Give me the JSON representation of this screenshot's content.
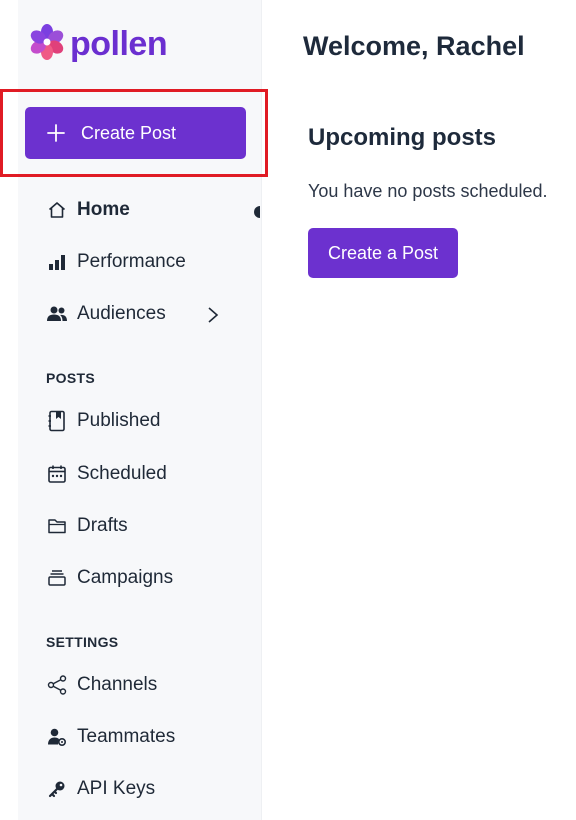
{
  "brand": {
    "name": "pollen",
    "color": "#6b2fd0",
    "logo_icon": "flower-icon"
  },
  "sidebar": {
    "create_post_label": "Create Post",
    "create_post_icon": "plus-icon",
    "highlight_color": "#e01b24",
    "nav": [
      {
        "label": "Home",
        "icon": "home-icon",
        "active": true
      },
      {
        "label": "Performance",
        "icon": "bar-chart-icon"
      },
      {
        "label": "Audiences",
        "icon": "people-icon",
        "has_submenu": true
      }
    ],
    "posts_section": {
      "title": "POSTS",
      "items": [
        {
          "label": "Published",
          "icon": "book-icon"
        },
        {
          "label": "Scheduled",
          "icon": "calendar-icon"
        },
        {
          "label": "Drafts",
          "icon": "folder-icon"
        },
        {
          "label": "Campaigns",
          "icon": "stack-icon"
        }
      ]
    },
    "settings_section": {
      "title": "SETTINGS",
      "items": [
        {
          "label": "Channels",
          "icon": "share-icon"
        },
        {
          "label": "Teammates",
          "icon": "user-gear-icon"
        },
        {
          "label": "API Keys",
          "icon": "key-icon"
        }
      ]
    }
  },
  "main": {
    "welcome": "Welcome, Rachel",
    "upcoming_title": "Upcoming posts",
    "empty_message": "You have no posts scheduled.",
    "create_button_label": "Create a Post"
  },
  "colors": {
    "accent": "#6c31cf",
    "sidebar_bg": "#f7f8fa",
    "text": "#1f2937"
  }
}
